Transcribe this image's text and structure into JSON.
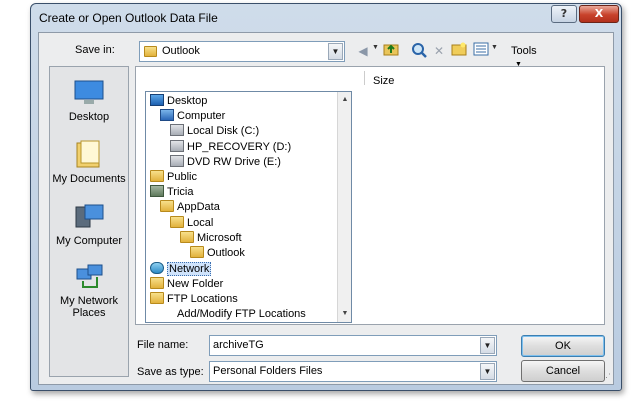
{
  "window": {
    "title": "Create or Open Outlook Data File",
    "help_label": "?",
    "close_label": "X"
  },
  "save_in": {
    "label": "Save in:",
    "value": "Outlook"
  },
  "toolbar": {
    "icons": [
      "back-icon",
      "up-folder-icon",
      "search-web-icon",
      "delete-icon",
      "new-folder-icon",
      "views-icon"
    ],
    "tools_label": "Tools"
  },
  "places": [
    {
      "label": "Desktop",
      "icon": "desktop-icon"
    },
    {
      "label": "My Documents",
      "icon": "my-documents-icon"
    },
    {
      "label": "My Computer",
      "icon": "my-computer-icon"
    },
    {
      "label": "My Network Places",
      "icon": "my-network-places-icon"
    }
  ],
  "file_list": {
    "size_header": "Size"
  },
  "dropdown_items": [
    {
      "label": "Desktop",
      "icon": "desktop-icon",
      "level": 0
    },
    {
      "label": "Computer",
      "icon": "computer-icon",
      "level": 1
    },
    {
      "label": "Local Disk (C:)",
      "icon": "drive-icon",
      "level": 2
    },
    {
      "label": "HP_RECOVERY (D:)",
      "icon": "drive-icon",
      "level": 2
    },
    {
      "label": "DVD RW Drive (E:)",
      "icon": "dvd-drive-icon",
      "level": 2
    },
    {
      "label": "Public",
      "icon": "folder-icon",
      "level": 0
    },
    {
      "label": "Tricia",
      "icon": "user-folder-icon",
      "level": 0
    },
    {
      "label": "AppData",
      "icon": "folder-icon",
      "level": 1
    },
    {
      "label": "Local",
      "icon": "folder-icon",
      "level": 2
    },
    {
      "label": "Microsoft",
      "icon": "folder-icon",
      "level": 3
    },
    {
      "label": "Outlook",
      "icon": "folder-icon",
      "level": 4
    },
    {
      "label": "Network",
      "icon": "network-icon",
      "level": 0,
      "selected": true
    },
    {
      "label": "New Folder",
      "icon": "folder-icon",
      "level": 0
    },
    {
      "label": "FTP Locations",
      "icon": "folder-icon",
      "level": 0
    },
    {
      "label": "Add/Modify FTP Locations",
      "icon": "",
      "level": 1
    }
  ],
  "file_name": {
    "label": "File name:",
    "value": "archiveTG"
  },
  "save_as_type": {
    "label": "Save as type:",
    "value": "Personal Folders Files"
  },
  "buttons": {
    "ok": "OK",
    "cancel": "Cancel"
  }
}
